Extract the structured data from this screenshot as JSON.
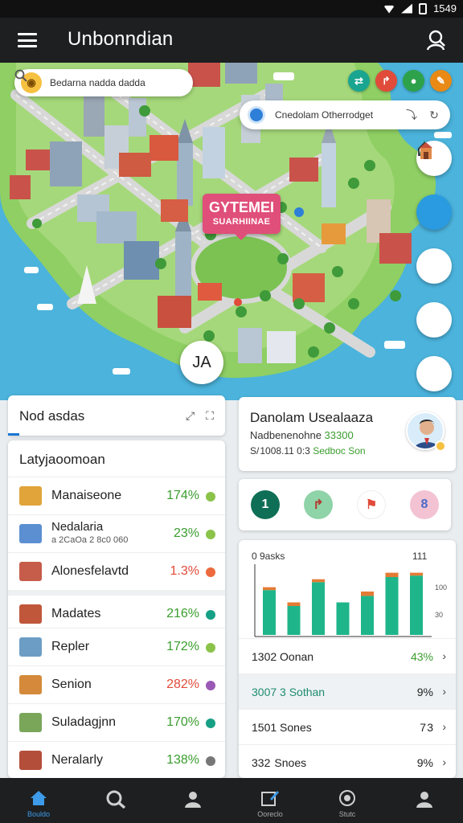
{
  "status_bar": {
    "time": "1549"
  },
  "app_bar": {
    "title": "Unbonndian"
  },
  "map": {
    "search_text": "Bedarna nadda dadda",
    "location_text": "Cnedolam Otherrodget",
    "label_line1": "GYTEMEI",
    "label_line2": "SUARHIINAE",
    "zoom_text": "JA",
    "top_buttons": [
      {
        "icon": "swap-icon",
        "color": "#1aa590",
        "glyph": "⇄"
      },
      {
        "icon": "route-icon",
        "color": "#e04b3a",
        "glyph": "↱"
      },
      {
        "icon": "pin-icon",
        "color": "#2ea24b",
        "glyph": "●"
      },
      {
        "icon": "tools-icon",
        "color": "#e98a16",
        "glyph": "✎"
      }
    ]
  },
  "panel_left": {
    "tab_title": "Nod asdas",
    "list_title": "Latyjaoomoan",
    "rows": [
      {
        "name": "Manaiseone",
        "sub": "",
        "pct": "174%",
        "pct_color": "#3a9d2e",
        "dot": "#8bc34a",
        "thumb": "#e0a43a"
      },
      {
        "name": "Nedalaria",
        "sub": "a 2CaOa 2 8c0 060",
        "pct": "23%",
        "pct_color": "#3a9d2e",
        "dot": "#8bc34a",
        "thumb": "#5b8fd1"
      },
      {
        "name": "Alonesfelavtd",
        "sub": "",
        "pct": "1.3%",
        "pct_color": "#e04b3a",
        "dot": "#ec6a3e",
        "thumb": "#c65c4a"
      },
      {
        "name": "Madates",
        "sub": "",
        "pct": "216%",
        "pct_color": "#3a9d2e",
        "dot": "#16a085",
        "thumb": "#c0573a"
      },
      {
        "name": "Repler",
        "sub": "",
        "pct": "172%",
        "pct_color": "#3a9d2e",
        "dot": "#8bc34a",
        "thumb": "#6c9ec5"
      },
      {
        "name": "Senion",
        "sub": "",
        "pct": "282%",
        "pct_color": "#e04b3a",
        "dot": "#9b59b6",
        "thumb": "#d48a3a"
      },
      {
        "name": "Suladagjnn",
        "sub": "",
        "pct": "170%",
        "pct_color": "#3a9d2e",
        "dot": "#16a085",
        "thumb": "#7aa65a"
      },
      {
        "name": "Neralarly",
        "sub": "",
        "pct": "138%",
        "pct_color": "#3a9d2e",
        "dot": "#777777",
        "thumb": "#b34e3a"
      }
    ]
  },
  "panel_right": {
    "detail": {
      "title": "Danolam Usealaaza",
      "line2_prefix": "Nadbenenohne",
      "line2_value": "33300",
      "line3_prefix": "S/ 1008.11 0:3",
      "line3_value": "Sedboc Son"
    },
    "actions": [
      {
        "icon": "number-one-icon",
        "glyph": "1",
        "bg": "#0f6e56",
        "fg": "#ffffff"
      },
      {
        "icon": "route-icon",
        "glyph": "↱",
        "bg": "#8fd3a8",
        "fg": "#b03a2e"
      },
      {
        "icon": "flag-icon",
        "glyph": "⚑",
        "bg": "#ffffff",
        "fg": "#e04b3a"
      },
      {
        "icon": "info-icon",
        "glyph": "8",
        "bg": "#f3c3d3",
        "fg": "#4a6bc6"
      }
    ],
    "stats": [
      {
        "label": "1302 Oonan",
        "value": "43%",
        "green": true
      },
      {
        "label": "3007 3 Sothan",
        "value": "9%",
        "green": false
      },
      {
        "label": "1501 Sones",
        "value": "7 3",
        "green": false
      },
      {
        "label": "332  Snoes",
        "value": "9%",
        "green": false
      }
    ]
  },
  "chart_data": {
    "type": "bar",
    "title": "0 9asks",
    "corner_value": "111",
    "right_ticks": [
      "100",
      "30"
    ],
    "series": [
      {
        "values": [
          62,
          40,
          73,
          45,
          54,
          80,
          82
        ]
      },
      {
        "values": [
          4,
          5,
          4,
          0,
          6,
          6,
          4
        ]
      }
    ],
    "colors": [
      "#1fb58a",
      "#e47b34"
    ],
    "ylim": [
      0,
      100
    ]
  },
  "bottom_nav": {
    "items": [
      {
        "label": "Bouldo",
        "icon": "home-icon"
      },
      {
        "label": "",
        "icon": "search-icon"
      },
      {
        "label": "",
        "icon": "person-icon"
      },
      {
        "label": "Ooreclo",
        "icon": "edit-icon"
      },
      {
        "label": "Stutc",
        "icon": "compass-icon"
      },
      {
        "label": "",
        "icon": "account-icon"
      }
    ]
  }
}
